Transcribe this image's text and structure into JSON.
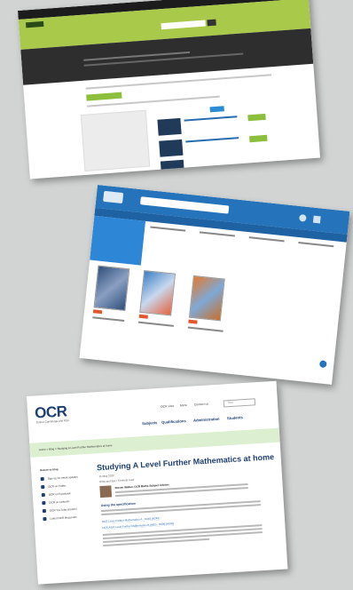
{
  "ocr": {
    "logo": "OCR",
    "tagline": "Oxford Cambridge and RSA",
    "top_menu": [
      "OCR sites",
      "Menu",
      "Contact us"
    ],
    "search_placeholder": "Sea",
    "nav": [
      "Subjects",
      "Qualifications",
      "Administration",
      "Students"
    ],
    "breadcrumb": "Home > Blog > Studying A Level Further Mathematics at home",
    "title": "Studying A Level Further Mathematics at home",
    "date": "11 May 2020",
    "meta": "Hints and tips  •  5 minute read",
    "author": "Steven Walker, OCR Maths Subject Adviser",
    "section_heading": "Using the specification",
    "links": [
      "OCR Level Further Mathematics A - H245 (H245)",
      "OCR AS/A Level Further Mathematics B (MEI) - H635 (H645)"
    ],
    "sidebar_title": "Return to blog",
    "sidebar": [
      "Sign up for email updates",
      "OCR on Twitter",
      "OCR on Facebook",
      "OCR on LinkedIn",
      "OCR YouTube channel",
      "Latest OCR blog posts"
    ]
  }
}
